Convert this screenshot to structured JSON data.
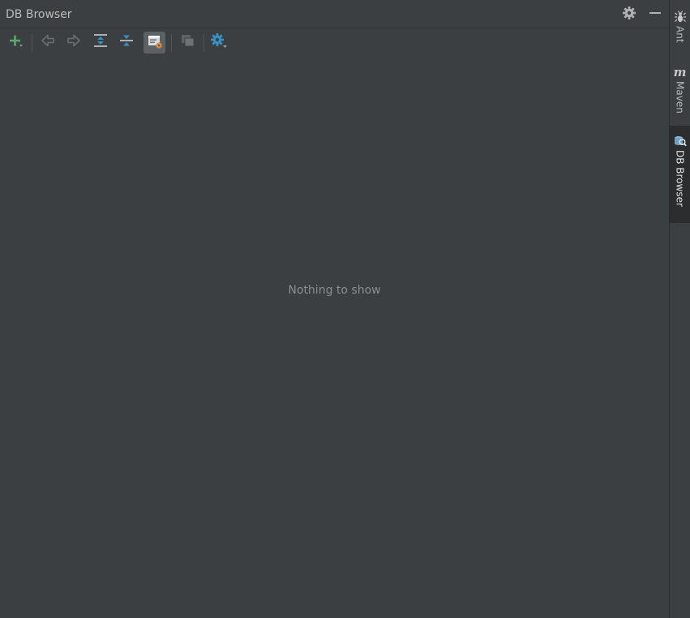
{
  "panel": {
    "title": "DB Browser",
    "empty_message": "Nothing to show"
  },
  "title_actions": [
    {
      "icon": "gear-icon"
    },
    {
      "icon": "minimize-icon"
    }
  ],
  "toolbar": {
    "buttons": [
      {
        "icon": "add-connection-icon",
        "active": false
      },
      {
        "icon": "navigate-back-icon",
        "active": false
      },
      {
        "icon": "navigate-forward-icon",
        "active": false
      },
      {
        "icon": "expand-all-icon",
        "active": false
      },
      {
        "icon": "collapse-all-icon",
        "active": false
      },
      {
        "icon": "object-properties-icon",
        "active": true
      },
      {
        "icon": "multiple-windows-icon",
        "active": false
      },
      {
        "icon": "settings-icon",
        "active": false
      }
    ]
  },
  "right_strip": {
    "tabs": [
      {
        "label": "Ant",
        "icon": "ant-icon",
        "selected": false
      },
      {
        "label": "Maven",
        "icon": "maven-icon",
        "selected": false
      },
      {
        "label": "DB Browser",
        "icon": "db-browser-icon",
        "selected": true
      }
    ]
  },
  "colors": {
    "background": "#3c3f41",
    "text": "#bbbbbb",
    "muted_text": "#8a8c8e",
    "accent_green": "#59a869",
    "accent_blue": "#3592c4",
    "accent_orange": "#e08a3c",
    "selected_tab": "#2b2d2f"
  }
}
